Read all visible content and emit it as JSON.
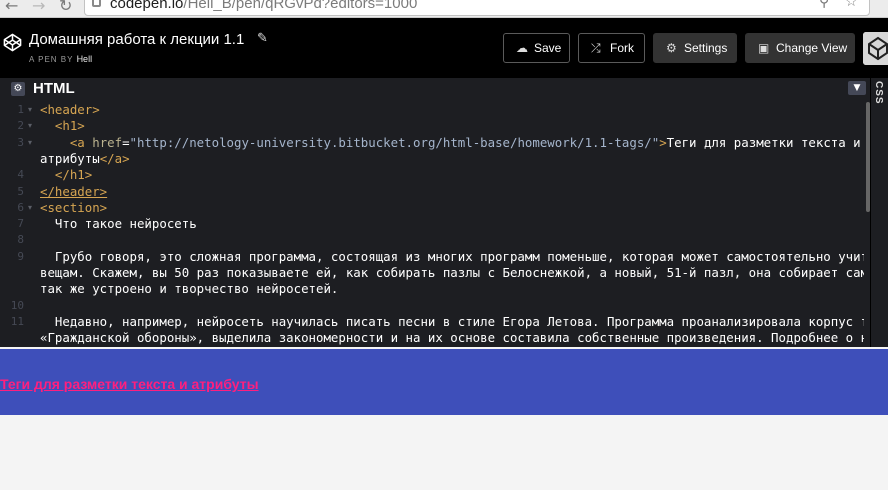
{
  "browser": {
    "back_icon": "back-arrow-icon",
    "forward_icon": "forward-arrow-icon",
    "reload_icon": "reload-icon",
    "url_host": "codepen.io",
    "url_path": "/Hell_B/pen/qRGvPd?editors=1000"
  },
  "header": {
    "title": "Домашняя работа к лекции 1.1",
    "pen_by": "A PEN BY",
    "author": "Hell",
    "buttons": {
      "save": "Save",
      "fork": "Fork",
      "settings": "Settings",
      "change_view": "Change View"
    }
  },
  "editor": {
    "name": "HTML",
    "side_tab": "CSS",
    "lines": [
      {
        "n": "1",
        "fold": true,
        "html": "<span class=\"tag\">&lt;header&gt;</span>"
      },
      {
        "n": "2",
        "fold": true,
        "html": "  <span class=\"tag\">&lt;h1&gt;</span>"
      },
      {
        "n": "3",
        "fold": true,
        "html": "    <span class=\"tag\">&lt;a</span> <span class=\"attr\">href</span><span class=\"plain\">=</span><span class=\"str\">\"http://netology-university.bitbucket.org/html-base/homework/1.1-tags/\"</span><span class=\"tag\">&gt;</span>Теги для разметки текста и"
      },
      {
        "n": "",
        "fold": false,
        "html": "атрибуты<span class=\"tag\">&lt;/a&gt;</span>"
      },
      {
        "n": "4",
        "fold": false,
        "html": "  <span class=\"tag\">&lt;/h1&gt;</span>"
      },
      {
        "n": "5",
        "fold": false,
        "html": "<span class=\"tag ul\">&lt;/header&gt;</span>"
      },
      {
        "n": "6",
        "fold": true,
        "html": "<span class=\"tag\">&lt;section&gt;</span>"
      },
      {
        "n": "7",
        "fold": false,
        "html": "  Что такое нейросеть"
      },
      {
        "n": "8",
        "fold": false,
        "html": ""
      },
      {
        "n": "9",
        "fold": false,
        "html": "  Грубо говоря, это сложная программа, состоящая из многих программ поменьше, которая может самостоятельно учиться разным"
      },
      {
        "n": "",
        "fold": false,
        "html": "вещам. Скажем, вы 50 раз показываете ей, как собирать пазлы с Белоснежкой, а новый, 51-й пазл, она собирает сама. Примерно"
      },
      {
        "n": "",
        "fold": false,
        "html": "так же устроено и творчество нейросетей."
      },
      {
        "n": "10",
        "fold": false,
        "html": ""
      },
      {
        "n": "11",
        "fold": false,
        "html": "  Недавно, например, нейросеть научилась писать песни в стиле Егора Летова. Программа проанализировала корпус текстов"
      },
      {
        "n": "",
        "fold": false,
        "html": "«Гражданской обороны», выделила закономерности и на их основе составила собственные произведения. Подробнее о нейросетях"
      }
    ]
  },
  "preview": {
    "link_text": "Теги для разметки текста и атрибуты",
    "link_href": "http://netology-university.bitbucket.org/html-base/homework/1.1-tags/"
  },
  "colors": {
    "preview_header_bg": "#3e4fba",
    "preview_link": "#ff1f7e",
    "editor_bg": "#1d1e22",
    "tag": "#d6a552"
  }
}
